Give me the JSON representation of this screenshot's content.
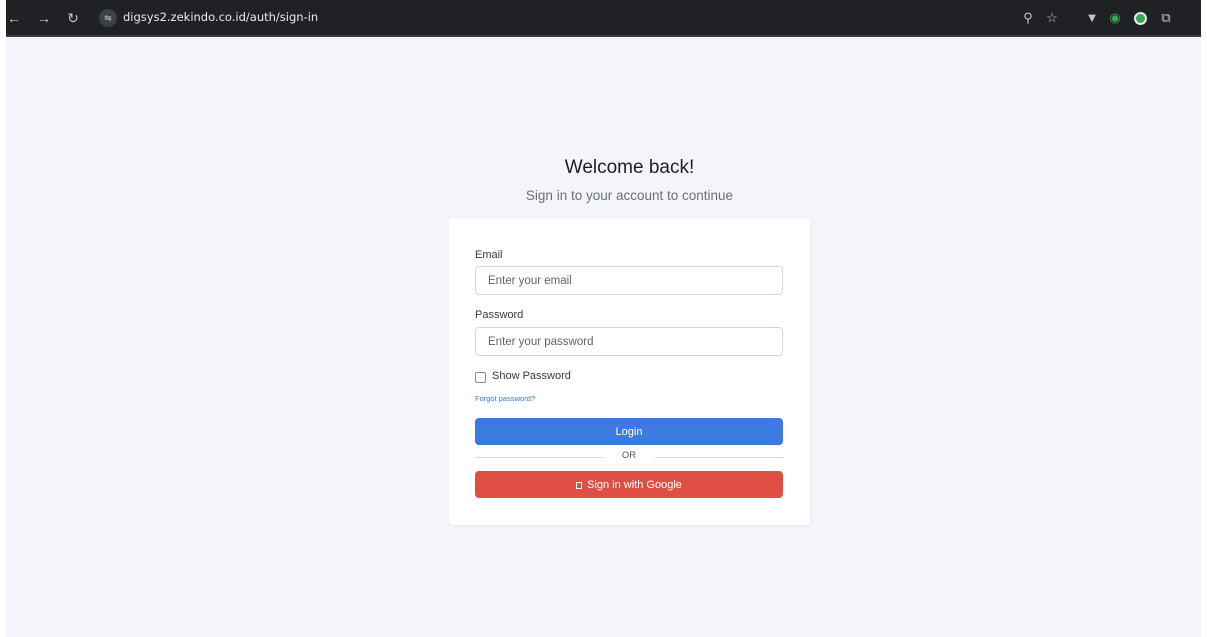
{
  "browser": {
    "url": "digsys2.zekindo.co.id/auth/sign-in",
    "icons": {
      "back": "back-arrow-icon",
      "forward": "forward-arrow-icon",
      "reload": "reload-icon",
      "site_info": "site-info-icon",
      "zoom": "zoom-icon",
      "bookmark": "star-icon",
      "extensions": [
        "vuetify-extension-icon",
        "eye-extension-icon",
        "green-extension-icon",
        "puzzle-extensions-icon"
      ]
    }
  },
  "page": {
    "title": "Welcome back!",
    "subtitle": "Sign in to your account to continue"
  },
  "form": {
    "email_label": "Email",
    "email_placeholder": "Enter your email",
    "email_value": "",
    "password_label": "Password",
    "password_placeholder": "Enter your password",
    "password_value": "",
    "show_password_label": "Show Password",
    "show_password_checked": false,
    "forgot_password": "Forgot password?",
    "login_button": "Login",
    "divider_text": "OR",
    "google_button": "Sign in with Google"
  },
  "colors": {
    "background": "#f4f5fa",
    "login_button": "#3b7be0",
    "google_button": "#e04f44",
    "link": "#3b74d6",
    "toolbar": "#202124"
  }
}
